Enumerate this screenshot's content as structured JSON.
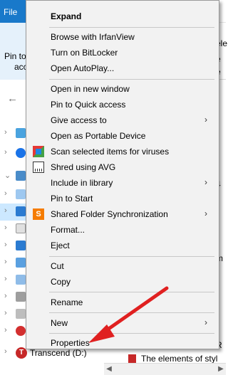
{
  "ribbon": {
    "file_tab": "File",
    "pin_label": "Pin to",
    "pin_label2": "acc",
    "right_fragments": [
      "ele",
      "e",
      "e"
    ]
  },
  "nav": {
    "bottom_item_label": "Transcend (D:)"
  },
  "content": {
    "file_fragment": "The elements of styl",
    "right_fragments": [
      "4",
      "R",
      "m"
    ]
  },
  "context_menu": {
    "items": [
      {
        "label": "Expand",
        "bold": true
      },
      {
        "label": "Browse with IrfanView"
      },
      {
        "label": "Turn on BitLocker"
      },
      {
        "label": "Open AutoPlay..."
      },
      {
        "label": "Open in new window"
      },
      {
        "label": "Pin to Quick access"
      },
      {
        "label": "Give access to",
        "submenu": true
      },
      {
        "label": "Open as Portable Device"
      },
      {
        "label": "Scan selected items for viruses",
        "icon": "avg-scan-icon"
      },
      {
        "label": "Shred using AVG",
        "icon": "shredder-icon"
      },
      {
        "label": "Include in library",
        "submenu": true
      },
      {
        "label": "Pin to Start"
      },
      {
        "label": "Shared Folder Synchronization",
        "submenu": true,
        "icon": "sync-icon"
      },
      {
        "label": "Format..."
      },
      {
        "label": "Eject"
      },
      {
        "label": "Cut"
      },
      {
        "label": "Copy"
      },
      {
        "label": "Rename"
      },
      {
        "label": "New",
        "submenu": true
      },
      {
        "label": "Properties"
      }
    ],
    "submenu_glyph": "›"
  },
  "colors": {
    "file_tab": "#1979ca",
    "menu_bg": "#f2f2f2",
    "arrow": "#e02020"
  }
}
